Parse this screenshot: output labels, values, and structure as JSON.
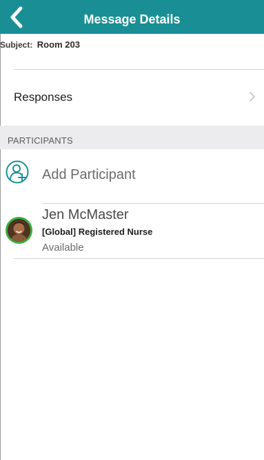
{
  "nav": {
    "title": "Message Details",
    "back_icon": "chevron-left-icon",
    "background_color": "#198f95"
  },
  "subject": {
    "label": "Subject:",
    "value": "Room 203"
  },
  "responses": {
    "label": "Responses",
    "chevron_icon": "chevron-right-icon"
  },
  "participants": {
    "header": "PARTICIPANTS",
    "add_label": "Add Participant",
    "add_icon": "add-user-icon",
    "items": [
      {
        "name": "Jen McMaster",
        "role": "[Global] Registered Nurse",
        "status": "Available",
        "status_ring_color": "#3cae3f"
      }
    ]
  }
}
